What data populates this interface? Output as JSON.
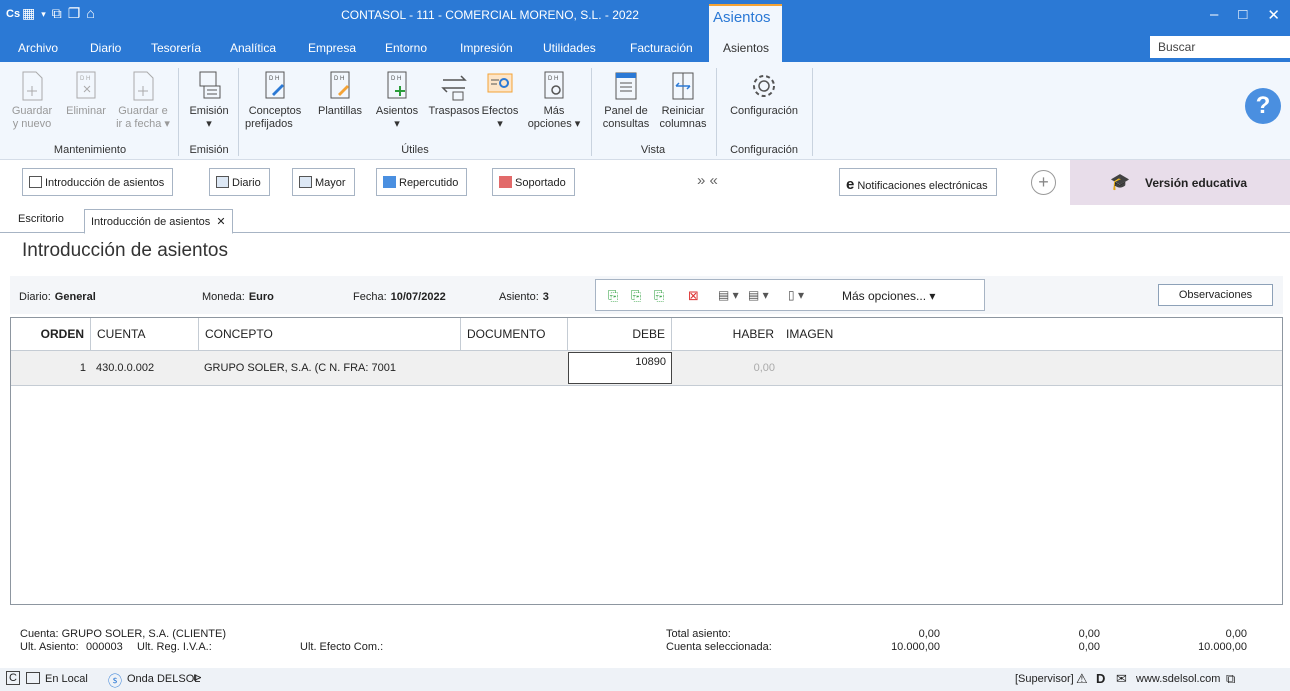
{
  "titlebar": {
    "app_badge": "Cs",
    "title": "CONTASOL - 111 - COMERCIAL MORENO, S.L. - 2022",
    "context_tab": "Asientos",
    "minimize": "–",
    "maximize": "□",
    "close": "✕"
  },
  "menubar": {
    "items": [
      "Archivo",
      "Diario",
      "Tesorería",
      "Analítica",
      "Empresa",
      "Entorno",
      "Impresión",
      "Utilidades",
      "Facturación"
    ],
    "active": "Asientos",
    "search_placeholder": "Buscar"
  },
  "ribbon": {
    "mantenimiento": {
      "group": "Mantenimiento",
      "guardar_nuevo": [
        "Guardar",
        "y nuevo"
      ],
      "eliminar": "Eliminar",
      "guardar_fecha": [
        "Guardar e",
        "ir a fecha ▾"
      ]
    },
    "emision": {
      "group": "Emisión",
      "button": "Emisión",
      "arrow": "▾"
    },
    "utiles": {
      "group": "Útiles",
      "conceptos": [
        "Conceptos",
        "prefijados"
      ],
      "plantillas": "Plantillas",
      "asientos": "Asientos",
      "traspasos": "Traspasos",
      "efectos": "Efectos",
      "mas_opciones": [
        "Más",
        "opciones ▾"
      ],
      "arrow": "▾"
    },
    "vista": {
      "group": "Vista",
      "panel": [
        "Panel de",
        "consultas"
      ],
      "reiniciar": [
        "Reiniciar",
        "columnas"
      ]
    },
    "configuracion": {
      "group": "Configuración",
      "button": "Configuración"
    },
    "help": "?"
  },
  "quickbar": {
    "introduccion": "Introducción de asientos",
    "diario": "Diario",
    "mayor": "Mayor",
    "repercutido": "Repercutido",
    "soportado": "Soportado",
    "arrows": "» «",
    "notificaciones": "Notificaciones electrónicas",
    "plus": "+",
    "version": "Versión educativa"
  },
  "tabs": {
    "escritorio": "Escritorio",
    "active": "Introducción de asientos",
    "close": "✕"
  },
  "page_title": "Introducción de asientos",
  "info": {
    "diario_label": "Diario:",
    "diario_value": "General",
    "moneda_label": "Moneda:",
    "moneda_value": "Euro",
    "fecha_label": "Fecha:",
    "fecha_value": "10/07/2022",
    "asiento_label": "Asiento:",
    "asiento_value": "3",
    "mas_opciones": "Más opciones... ▾",
    "observaciones": "Observaciones"
  },
  "grid": {
    "headers": {
      "orden": "ORDEN",
      "cuenta": "CUENTA",
      "concepto": "CONCEPTO",
      "documento": "DOCUMENTO",
      "debe": "DEBE",
      "haber": "HABER",
      "imagen": "IMAGEN"
    },
    "rows": [
      {
        "orden": "1",
        "cuenta": "430.0.0.002",
        "concepto": "GRUPO SOLER, S.A. (C N. FRA: 7001",
        "documento": "",
        "debe": "10890",
        "haber": "0,00"
      }
    ]
  },
  "footer": {
    "cuenta": "Cuenta: GRUPO SOLER, S.A. (CLIENTE)",
    "ult_asiento_label": "Ult. Asiento:",
    "ult_asiento_value": "000003",
    "ult_reg_iva": "Ult. Reg. I.V.A.:",
    "ult_efecto": "Ult. Efecto Com.:",
    "total_asiento": "Total asiento:",
    "cuenta_seleccionada": "Cuenta seleccionada:",
    "total_debe": "0,00",
    "total_haber": "0,00",
    "total_saldo": "0,00",
    "sel_debe": "10.000,00",
    "sel_haber": "0,00",
    "sel_saldo": "10.000,00"
  },
  "status": {
    "c": "C",
    "local": "En Local",
    "onda": "Onda DELSOL",
    "supervisor": "[Supervisor]",
    "web": "www.sdelsol.com"
  }
}
